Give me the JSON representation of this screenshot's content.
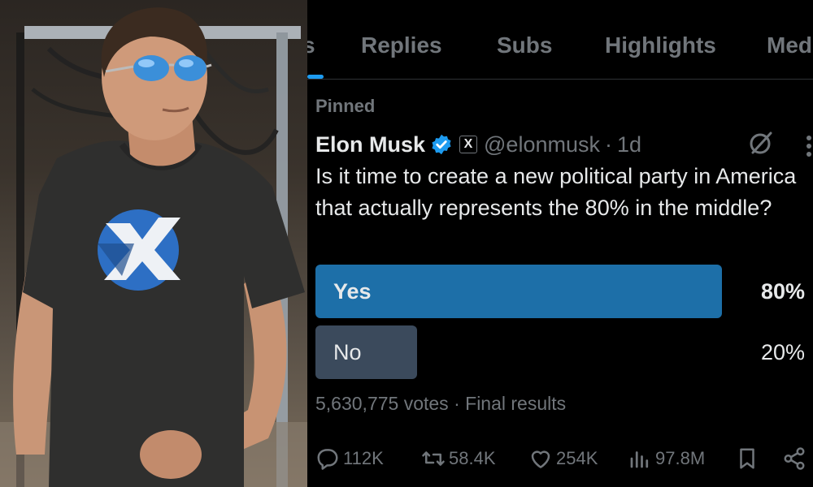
{
  "tabs": {
    "items": [
      {
        "label": "s"
      },
      {
        "label": "Replies"
      },
      {
        "label": "Subs"
      },
      {
        "label": "Highlights"
      },
      {
        "label": "Med"
      }
    ]
  },
  "tweet": {
    "pinned_label": "Pinned",
    "author_name": "Elon Musk",
    "x_badge": "X",
    "handle": "@elonmusk",
    "separator": "·",
    "age": "1d",
    "text": "Is it time to create a new political party in America that actually represents the 80% in the middle?"
  },
  "poll": {
    "options": [
      {
        "label": "Yes",
        "percent_text": "80%",
        "percent": 80,
        "winner": true
      },
      {
        "label": "No",
        "percent_text": "20%",
        "percent": 20,
        "winner": false
      }
    ],
    "votes": "5,630,775 votes",
    "separator": "·",
    "status": "Final results"
  },
  "actions": {
    "replies": "112K",
    "reposts": "58.4K",
    "likes": "254K",
    "views": "97.8M"
  },
  "colors": {
    "background": "#000000",
    "accent_blue": "#1d9bf0",
    "poll_winner": "#1d6fa8",
    "poll_loser": "#3b4a5c",
    "muted_text": "#71767b",
    "primary_text": "#e7e9ea"
  },
  "icons": {
    "verified": "verified-badge-icon",
    "grok": "grok-icon",
    "more": "more-dots-icon",
    "reply": "reply-icon",
    "repost": "repost-icon",
    "like": "heart-icon",
    "views": "views-chart-icon",
    "bookmark": "bookmark-icon",
    "share": "share-icon"
  }
}
